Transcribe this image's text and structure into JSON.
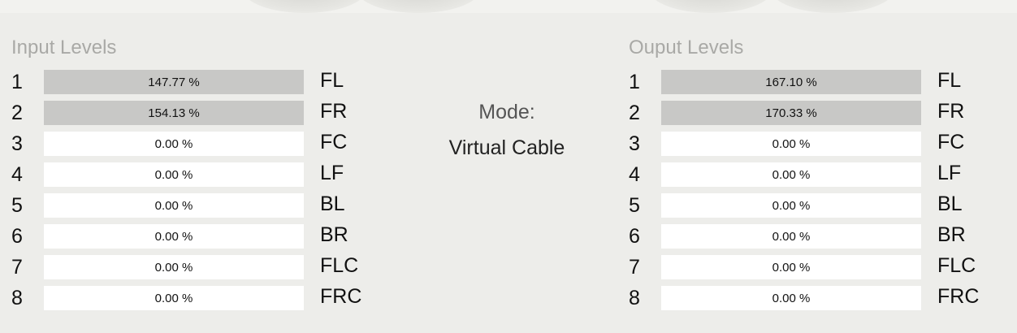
{
  "input": {
    "title": "Input Levels",
    "rows": [
      {
        "num": "1",
        "level": "147.77 %",
        "fill": 1.0,
        "channel": "FL"
      },
      {
        "num": "2",
        "level": "154.13 %",
        "fill": 1.0,
        "channel": "FR"
      },
      {
        "num": "3",
        "level": "0.00 %",
        "fill": 0,
        "channel": "FC"
      },
      {
        "num": "4",
        "level": "0.00 %",
        "fill": 0,
        "channel": "LF"
      },
      {
        "num": "5",
        "level": "0.00 %",
        "fill": 0,
        "channel": "BL"
      },
      {
        "num": "6",
        "level": "0.00 %",
        "fill": 0,
        "channel": "BR"
      },
      {
        "num": "7",
        "level": "0.00 %",
        "fill": 0,
        "channel": "FLC"
      },
      {
        "num": "8",
        "level": "0.00 %",
        "fill": 0,
        "channel": "FRC"
      }
    ]
  },
  "output": {
    "title": "Ouput Levels",
    "rows": [
      {
        "num": "1",
        "level": "167.10 %",
        "fill": 1.0,
        "channel": "FL"
      },
      {
        "num": "2",
        "level": "170.33 %",
        "fill": 1.0,
        "channel": "FR"
      },
      {
        "num": "3",
        "level": "0.00 %",
        "fill": 0,
        "channel": "FC"
      },
      {
        "num": "4",
        "level": "0.00 %",
        "fill": 0,
        "channel": "LF"
      },
      {
        "num": "5",
        "level": "0.00 %",
        "fill": 0,
        "channel": "BL"
      },
      {
        "num": "6",
        "level": "0.00 %",
        "fill": 0,
        "channel": "BR"
      },
      {
        "num": "7",
        "level": "0.00 %",
        "fill": 0,
        "channel": "FLC"
      },
      {
        "num": "8",
        "level": "0.00 %",
        "fill": 0,
        "channel": "FRC"
      }
    ]
  },
  "mode": {
    "label": "Mode:",
    "value": "Virtual Cable"
  },
  "colors": {
    "background": "#ededea",
    "bar_empty": "#ffffff",
    "bar_fill": "#c8c8c6",
    "title": "#a9a9a6"
  }
}
